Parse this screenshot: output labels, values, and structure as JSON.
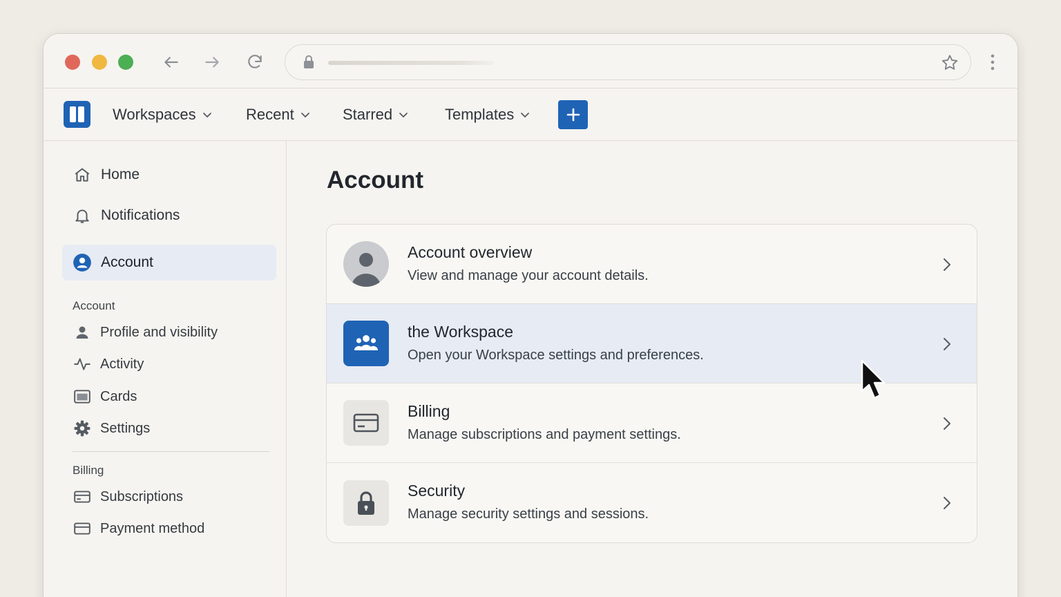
{
  "browser": {
    "back_icon": "arrow-left-icon",
    "forward_icon": "arrow-right-icon",
    "reload_icon": "reload-icon",
    "lock_icon": "lock-icon",
    "star_icon": "star-icon",
    "menu_icon": "more-vertical-icon"
  },
  "header": {
    "nav": [
      {
        "label": "Workspaces"
      },
      {
        "label": "Recent"
      },
      {
        "label": "Starred"
      },
      {
        "label": "Templates"
      }
    ],
    "accent": "#1f63b5"
  },
  "sidebar": {
    "items": [
      {
        "label": "Home",
        "icon": "home-icon"
      },
      {
        "label": "Notifications",
        "icon": "bell-icon"
      },
      {
        "label": "Account",
        "icon": "user-circle-icon",
        "active": true
      }
    ],
    "account_heading": "Account",
    "account_items": [
      {
        "label": "Profile and visibility",
        "icon": "user-icon"
      },
      {
        "label": "Activity",
        "icon": "activity-icon"
      },
      {
        "label": "Cards",
        "icon": "card-icon"
      },
      {
        "label": "Settings",
        "icon": "gear-icon"
      }
    ],
    "billing_heading": "Billing",
    "billing_items": [
      {
        "label": "Subscriptions",
        "icon": "credit-card-icon"
      },
      {
        "label": "Payment method",
        "icon": "credit-card-icon"
      }
    ]
  },
  "main": {
    "title": "Account",
    "rows": [
      {
        "title": "Account overview",
        "desc": "View and manage your account details.",
        "icon": "avatar"
      },
      {
        "title": "the Workspace",
        "desc": "Open your Workspace settings and preferences.",
        "icon": "team-icon",
        "highlighted": true
      },
      {
        "title": "Billing",
        "desc": "Manage subscriptions and payment settings.",
        "icon": "credit-card-icon"
      },
      {
        "title": "Security",
        "desc": "Manage security settings and sessions.",
        "icon": "lock-icon"
      }
    ]
  }
}
